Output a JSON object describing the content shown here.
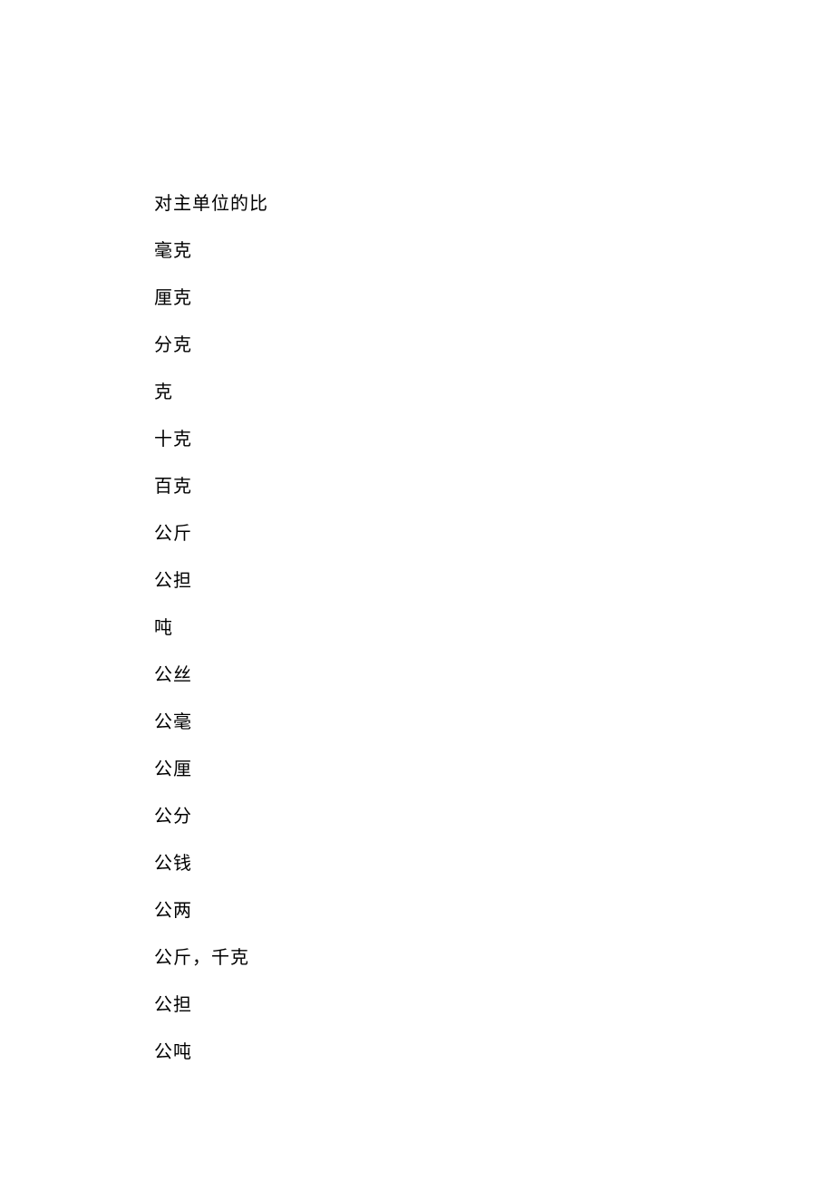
{
  "lines": [
    "对主单位的比",
    "毫克",
    "厘克",
    "分克",
    "克",
    "十克",
    "百克",
    "公斤",
    "公担",
    "吨",
    "公丝",
    "公毫",
    "公厘",
    "公分",
    "公钱",
    "公两",
    "公斤，千克",
    "公担",
    "公吨"
  ]
}
